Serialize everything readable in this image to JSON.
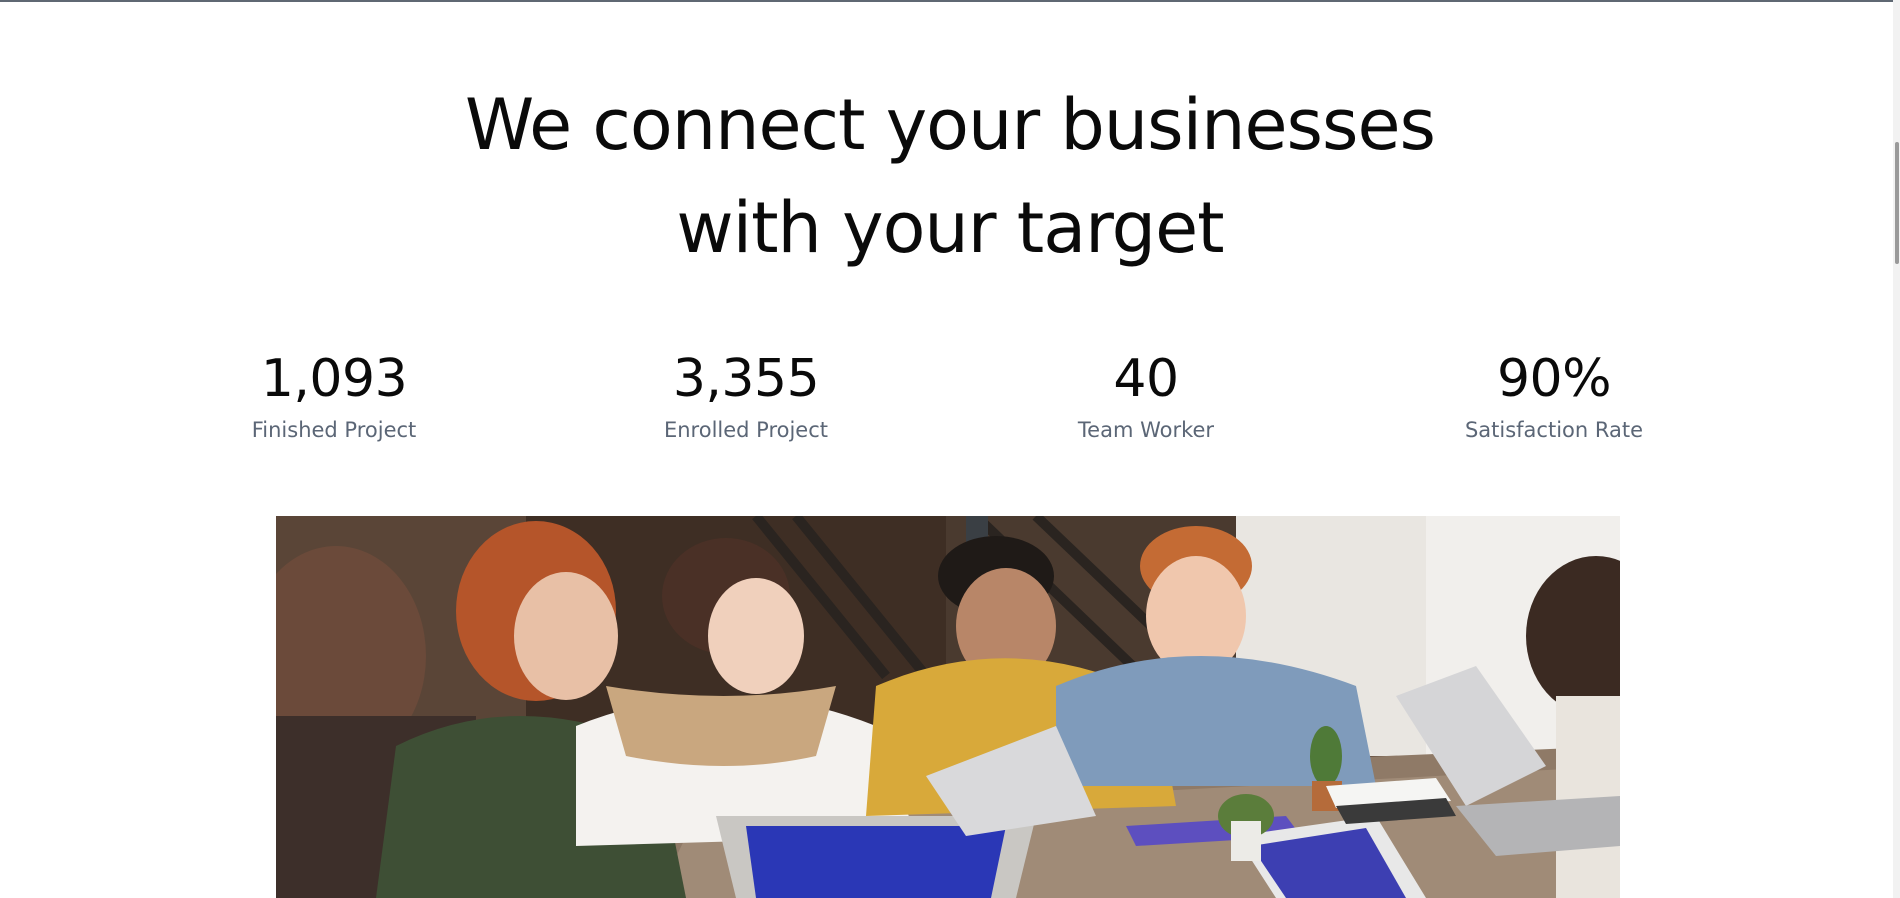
{
  "hero": {
    "headline_line1": "We connect your businesses",
    "headline_line2": "with your target"
  },
  "stats": [
    {
      "value": "1,093",
      "label": "Finished Project"
    },
    {
      "value": "3,355",
      "label": "Enrolled Project"
    },
    {
      "value": "40",
      "label": "Team Worker"
    },
    {
      "value": "90%",
      "label": "Satisfaction Rate"
    }
  ],
  "colors": {
    "headline": "#0a0a0a",
    "stat_label": "#5b6676",
    "top_border": "#5f6873"
  }
}
